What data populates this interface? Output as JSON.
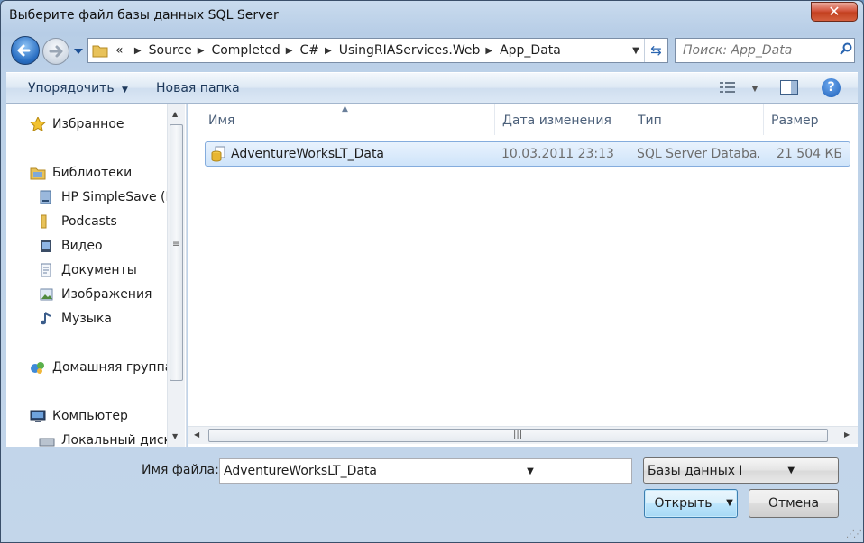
{
  "window": {
    "title": "Выберите файл базы данных SQL Server",
    "close_label": "✕"
  },
  "address": {
    "overflow": "«",
    "crumbs": [
      "Source",
      "Completed",
      "C#",
      "UsingRIAServices.Web",
      "App_Data"
    ]
  },
  "search": {
    "placeholder": "Поиск: App_Data"
  },
  "toolbar": {
    "organize": "Упорядочить",
    "new_folder": "Новая папка",
    "help": "?"
  },
  "nav": {
    "favorites": "Избранное",
    "libraries": "Библиотеки",
    "lib_items": [
      "HP SimpleSave (F",
      "Podcasts",
      "Видео",
      "Документы",
      "Изображения",
      "Музыка"
    ],
    "homegroup": "Домашняя группа",
    "computer": "Компьютер",
    "local_disk": "Локальный диск"
  },
  "columns": {
    "name": "Имя",
    "date": "Дата изменения",
    "type": "Тип",
    "size": "Размер"
  },
  "files": [
    {
      "name": "AdventureWorksLT_Data",
      "date": "10.03.2011 23:13",
      "type": "SQL Server Databa...",
      "size": "21 504 КБ"
    }
  ],
  "bottom": {
    "filename_label": "Имя файла:",
    "filename_value": "AdventureWorksLT_Data",
    "filter_value": "Базы данных Microsoft SQL",
    "open_label": "Открыть",
    "cancel_label": "Отмена"
  }
}
